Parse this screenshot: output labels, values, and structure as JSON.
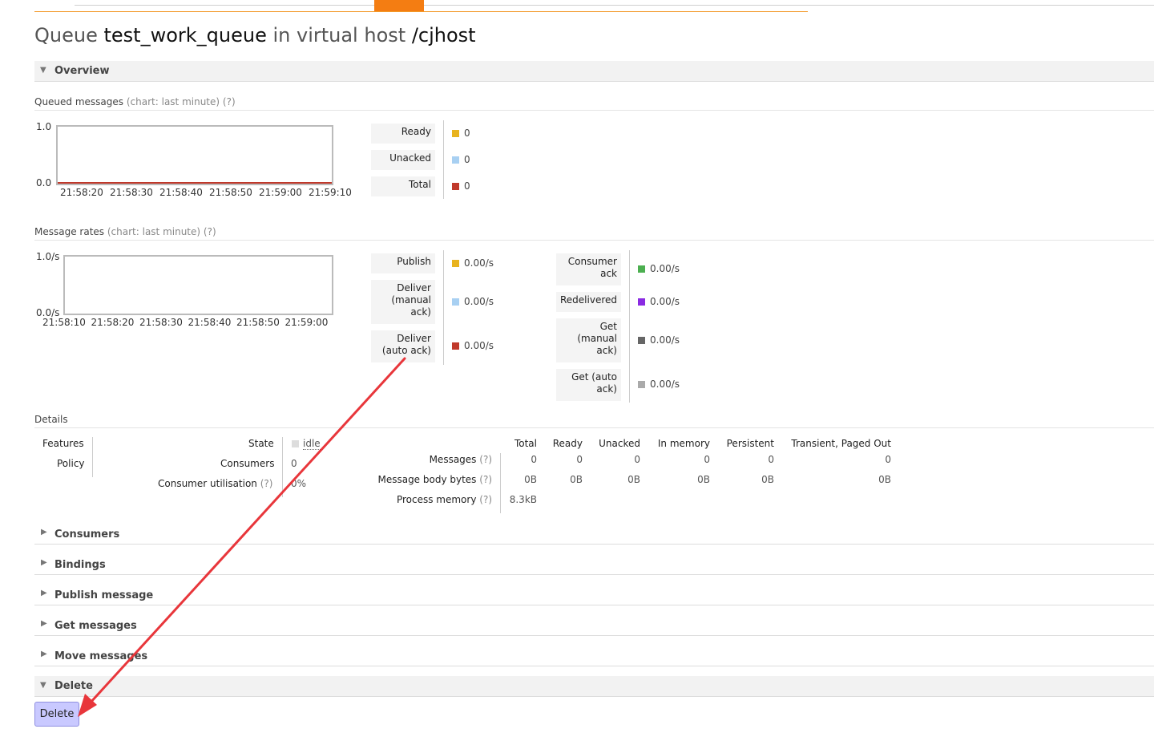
{
  "page": {
    "title_prefix": "Queue",
    "queue_name": "test_work_queue",
    "title_mid": "in virtual host",
    "vhost": "/cjhost"
  },
  "sections": {
    "overview": "Overview",
    "consumers": "Consumers",
    "bindings": "Bindings",
    "publish_message": "Publish message",
    "get_messages": "Get messages",
    "move_messages": "Move messages",
    "delete": "Delete"
  },
  "queued_messages": {
    "heading": "Queued messages",
    "chart_note": "(chart: last minute)",
    "help": "(?)",
    "chart_data": {
      "type": "line",
      "x": [
        "21:58:20",
        "21:58:30",
        "21:58:40",
        "21:58:50",
        "21:59:00",
        "21:59:10"
      ],
      "y_ticks": [
        "1.0",
        "0.0"
      ],
      "ylim": [
        0,
        1
      ],
      "series": [
        {
          "name": "Ready",
          "values": [
            0,
            0,
            0,
            0,
            0,
            0
          ],
          "color": "#e8b31e"
        },
        {
          "name": "Unacked",
          "values": [
            0,
            0,
            0,
            0,
            0,
            0
          ],
          "color": "#a8d0f2"
        },
        {
          "name": "Total",
          "values": [
            0,
            0,
            0,
            0,
            0,
            0
          ],
          "color": "#c0392b"
        }
      ]
    },
    "legend": [
      {
        "label": "Ready",
        "value": "0",
        "color": "#e8b31e"
      },
      {
        "label": "Unacked",
        "value": "0",
        "color": "#a8d0f2"
      },
      {
        "label": "Total",
        "value": "0",
        "color": "#c0392b"
      }
    ]
  },
  "message_rates": {
    "heading": "Message rates",
    "chart_note": "(chart: last minute)",
    "help": "(?)",
    "chart_data": {
      "type": "line",
      "x": [
        "21:58:10",
        "21:58:20",
        "21:58:30",
        "21:58:40",
        "21:58:50",
        "21:59:00"
      ],
      "y_ticks": [
        "1.0/s",
        "0.0/s"
      ],
      "ylim": [
        0,
        1
      ],
      "series": []
    },
    "legend_left": [
      {
        "label": "Publish",
        "value": "0.00/s",
        "color": "#e8b31e"
      },
      {
        "label": "Deliver (manual ack)",
        "value": "0.00/s",
        "color": "#a8d0f2"
      },
      {
        "label": "Deliver (auto ack)",
        "value": "0.00/s",
        "color": "#c0392b"
      }
    ],
    "legend_right": [
      {
        "label": "Consumer ack",
        "value": "0.00/s",
        "color": "#4caf50"
      },
      {
        "label": "Redelivered",
        "value": "0.00/s",
        "color": "#8a2be2"
      },
      {
        "label": "Get (manual ack)",
        "value": "0.00/s",
        "color": "#666666"
      },
      {
        "label": "Get (auto ack)",
        "value": "0.00/s",
        "color": "#aaaaaa"
      }
    ]
  },
  "details": {
    "heading": "Details",
    "features_label": "Features",
    "policy_label": "Policy",
    "state_label": "State",
    "state_value": "idle",
    "consumers_label": "Consumers",
    "consumers_value": "0",
    "utilisation_label": "Consumer utilisation",
    "utilisation_help": "(?)",
    "utilisation_value": "0%",
    "columns": [
      "Total",
      "Ready",
      "Unacked",
      "In memory",
      "Persistent",
      "Transient, Paged Out"
    ],
    "rows": [
      {
        "label": "Messages",
        "help": "(?)",
        "values": [
          "0",
          "0",
          "0",
          "0",
          "0",
          "0"
        ]
      },
      {
        "label": "Message body bytes",
        "help": "(?)",
        "values": [
          "0B",
          "0B",
          "0B",
          "0B",
          "0B",
          "0B"
        ]
      },
      {
        "label": "Process memory",
        "help": "(?)",
        "values": [
          "8.3kB",
          "",
          "",
          "",
          "",
          ""
        ]
      }
    ]
  },
  "delete_button": "Delete",
  "annotation_color": "#e8363b"
}
